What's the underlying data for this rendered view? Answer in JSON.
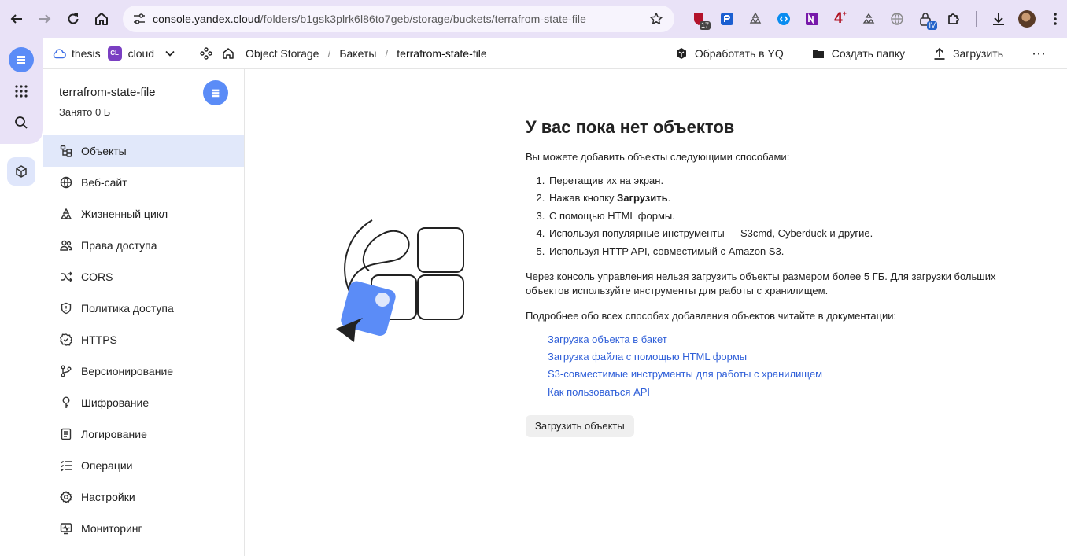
{
  "browser": {
    "url_host": "console.yandex.cloud",
    "url_path": "/folders/b1gsk3plrk6l86to7geb/storage/buckets/terrafrom-state-file",
    "ext_badge_1": "17",
    "ext_badge_2": "IV",
    "ext_4_label": "4"
  },
  "header": {
    "org": "thesis",
    "cloud_badge": "CL",
    "cloud": "cloud",
    "breadcrumbs": [
      "Object Storage",
      "Бакеты",
      "terrafrom-state-file"
    ],
    "actions": {
      "yq": "Обработать в YQ",
      "create_folder": "Создать папку",
      "upload": "Загрузить",
      "more": "⋯"
    }
  },
  "sidebar": {
    "bucket_name": "terrafrom-state-file",
    "bucket_size": "Занято 0 Б",
    "items": [
      {
        "label": "Объекты",
        "icon": "objects-icon",
        "active": true
      },
      {
        "label": "Веб-сайт",
        "icon": "globe-icon"
      },
      {
        "label": "Жизненный цикл",
        "icon": "lifecycle-icon"
      },
      {
        "label": "Права доступа",
        "icon": "users-icon"
      },
      {
        "label": "CORS",
        "icon": "shuffle-icon"
      },
      {
        "label": "Политика доступа",
        "icon": "shield-icon"
      },
      {
        "label": "HTTPS",
        "icon": "check-badge-icon"
      },
      {
        "label": "Версионирование",
        "icon": "branch-icon"
      },
      {
        "label": "Шифрование",
        "icon": "key-icon"
      },
      {
        "label": "Логирование",
        "icon": "log-icon"
      },
      {
        "label": "Операции",
        "icon": "list-check-icon"
      },
      {
        "label": "Настройки",
        "icon": "gear-icon"
      },
      {
        "label": "Мониторинг",
        "icon": "monitor-icon"
      }
    ]
  },
  "main": {
    "title": "У вас пока нет объектов",
    "intro": "Вы можете добавить объекты следующими способами:",
    "ways": [
      "Перетащив их на экран.",
      "Нажав кнопку",
      "С помощью HTML формы.",
      "Используя популярные инструменты — S3cmd, Cyberduck и другие.",
      "Используя HTTP API, совместимый с Amazon S3."
    ],
    "way2_bold": "Загрузить",
    "way2_end": ".",
    "limit_note": "Через консоль управления нельзя загрузить объекты размером более 5 ГБ. Для загрузки больших объектов используйте инструменты для работы с хранилищем.",
    "docs_note": "Подробнее обо всех способах добавления объектов читайте в документации:",
    "links": [
      "Загрузка объекта в бакет",
      "Загрузка файла с помощью HTML формы",
      "S3-совместимые инструменты для работы с хранилищем",
      "Как пользоваться API"
    ],
    "upload_button": "Загрузить объекты"
  },
  "colors": {
    "accent": "#5b8cf7",
    "chrome": "#e9e2f7",
    "active_menu": "#e1e8fa",
    "link": "#2f5fd8"
  }
}
